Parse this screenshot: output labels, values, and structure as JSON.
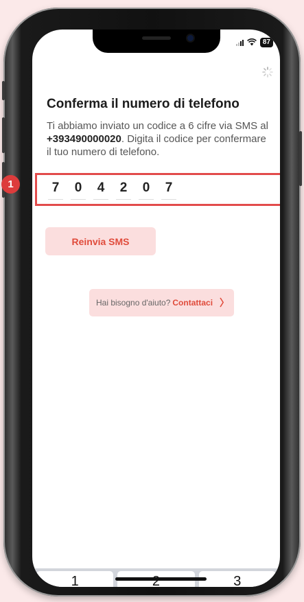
{
  "status_bar": {
    "battery": "87",
    "wifi_icon": "wifi-icon"
  },
  "header": {
    "title": "Conferma il numero di telefono"
  },
  "message": {
    "part1": "Ti abbiamo inviato un codice a 6 cifre via SMS al ",
    "phone": "+393490000020",
    "part2": ". Digita il codice per confermare il tuo numero di telefono."
  },
  "code": {
    "digits": [
      "7",
      "0",
      "4",
      "2",
      "0",
      "7"
    ]
  },
  "annotation": {
    "marker": "1"
  },
  "buttons": {
    "resend": "Reinvia SMS"
  },
  "help": {
    "question": "Hai bisogno d'aiuto?",
    "link": "Contattaci",
    "arrow": "〉"
  },
  "keypad": {
    "keys": [
      "1",
      "2",
      "3"
    ]
  },
  "colors": {
    "accent": "#e04b3b",
    "accent_bg": "#fbdede",
    "highlight": "#e24b4b"
  }
}
